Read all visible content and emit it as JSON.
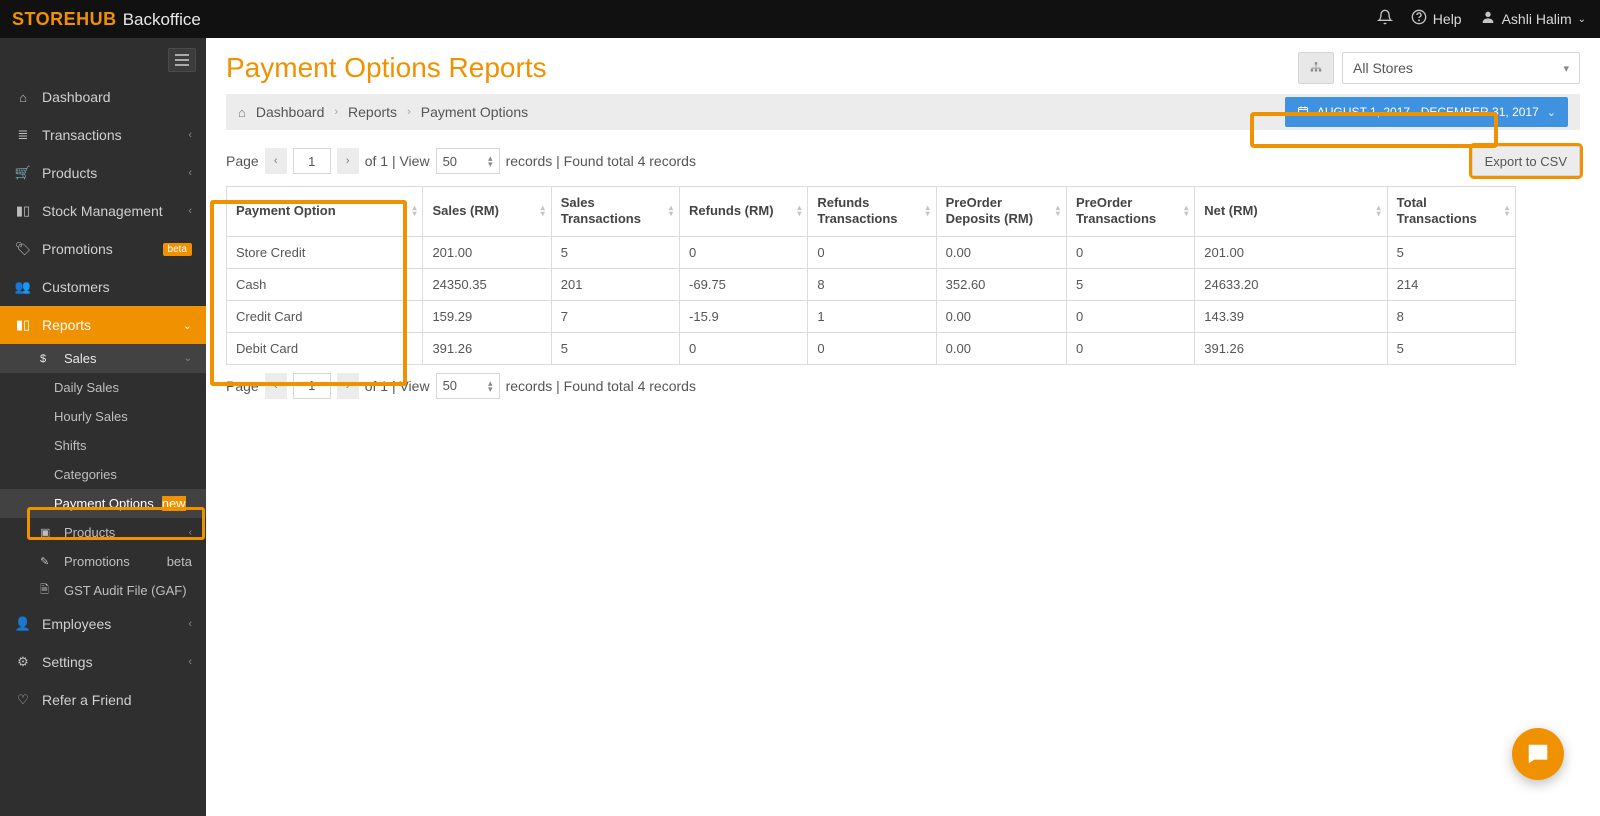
{
  "header": {
    "brand_bold": "STOREHUB",
    "brand_sub": "Backoffice",
    "help": "Help",
    "user": "Ashli Halim"
  },
  "sidebar": {
    "dashboard": "Dashboard",
    "transactions": "Transactions",
    "products": "Products",
    "stock": "Stock Management",
    "promotions": "Promotions",
    "promotions_badge": "beta",
    "customers": "Customers",
    "reports": "Reports",
    "sales": "Sales",
    "daily_sales": "Daily Sales",
    "hourly_sales": "Hourly Sales",
    "shifts": "Shifts",
    "categories": "Categories",
    "payment_options": "Payment Options",
    "payment_options_badge": "new",
    "r_products": "Products",
    "r_promotions": "Promotions",
    "r_promotions_badge": "beta",
    "gst": "GST Audit File (GAF)",
    "employees": "Employees",
    "settings": "Settings",
    "refer": "Refer a Friend"
  },
  "page": {
    "title": "Payment Options Reports",
    "store_select": "All Stores",
    "crumb1": "Dashboard",
    "crumb2": "Reports",
    "crumb3": "Payment Options",
    "date_range": "AUGUST 1, 2017 - DECEMBER 31, 2017",
    "export": "Export to CSV"
  },
  "pager": {
    "page_label": "Page",
    "page_value": "1",
    "of": "of 1 | View",
    "view_value": "50",
    "records_label": "records | Found total 4 records"
  },
  "table": {
    "headers": {
      "po": "Payment Option",
      "sales": "Sales (RM)",
      "st": "Sales Transactions",
      "ref": "Refunds (RM)",
      "rt": "Refunds Transactions",
      "pd": "PreOrder Deposits (RM)",
      "pt": "PreOrder Transactions",
      "net": "Net (RM)",
      "tt": "Total Transactions"
    },
    "rows": [
      {
        "po": "Store Credit",
        "sales": "201.00",
        "st": "5",
        "ref": "0",
        "rt": "0",
        "pd": "0.00",
        "pt": "0",
        "net": "201.00",
        "tt": "5"
      },
      {
        "po": "Cash",
        "sales": "24350.35",
        "st": "201",
        "ref": "-69.75",
        "rt": "8",
        "pd": "352.60",
        "pt": "5",
        "net": "24633.20",
        "tt": "214"
      },
      {
        "po": "Credit Card",
        "sales": "159.29",
        "st": "7",
        "ref": "-15.9",
        "rt": "1",
        "pd": "0.00",
        "pt": "0",
        "net": "143.39",
        "tt": "8"
      },
      {
        "po": "Debit Card",
        "sales": "391.26",
        "st": "5",
        "ref": "0",
        "rt": "0",
        "pd": "0.00",
        "pt": "0",
        "net": "391.26",
        "tt": "5"
      }
    ]
  }
}
